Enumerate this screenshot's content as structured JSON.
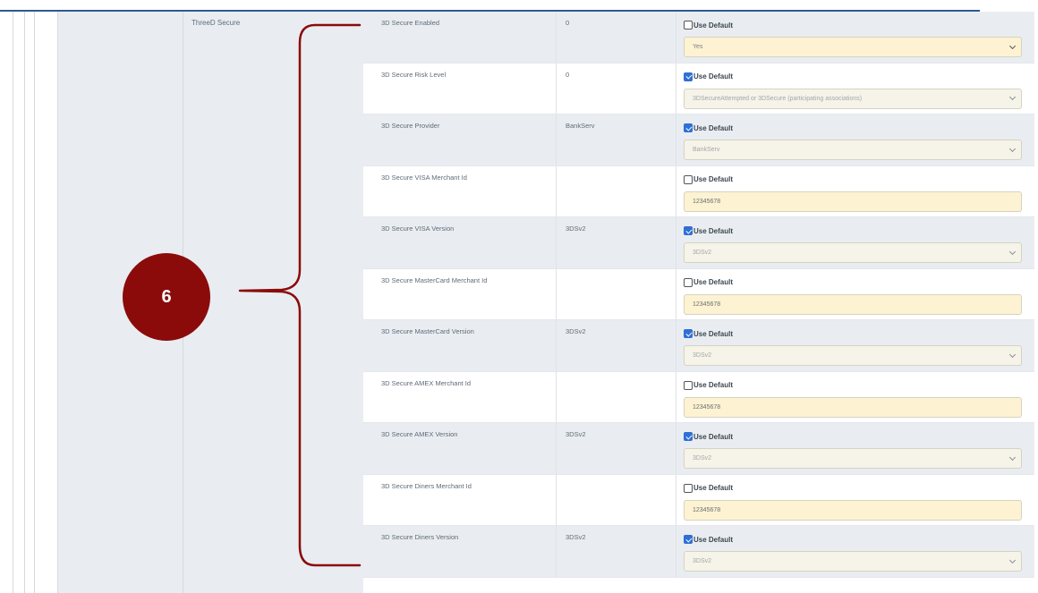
{
  "group": {
    "title": "ThreeD Secure"
  },
  "callout": {
    "number": "6",
    "color": "#8b0b0b"
  },
  "use_default_label": "Use Default",
  "rows": [
    {
      "name": "3D Secure Enabled",
      "value": "0",
      "use_default": false,
      "control": "select",
      "field": "Yes"
    },
    {
      "name": "3D Secure Risk Level",
      "value": "0",
      "use_default": true,
      "control": "select",
      "field": "3DSecureAttempted or 3DSecure (participating associations)"
    },
    {
      "name": "3D Secure Provider",
      "value": "BankServ",
      "use_default": true,
      "control": "select",
      "field": "BankServ"
    },
    {
      "name": "3D Secure VISA Merchant Id",
      "value": "",
      "use_default": false,
      "control": "input",
      "field": "12345678"
    },
    {
      "name": "3D Secure VISA Version",
      "value": "3DSv2",
      "use_default": true,
      "control": "select",
      "field": "3DSv2"
    },
    {
      "name": "3D Secure MasterCard Merchant Id",
      "value": "",
      "use_default": false,
      "control": "input",
      "field": "12345678"
    },
    {
      "name": "3D Secure MasterCard Version",
      "value": "3DSv2",
      "use_default": true,
      "control": "select",
      "field": "3DSv2"
    },
    {
      "name": "3D Secure AMEX Merchant Id",
      "value": "",
      "use_default": false,
      "control": "input",
      "field": "12345678"
    },
    {
      "name": "3D Secure AMEX Version",
      "value": "3DSv2",
      "use_default": true,
      "control": "select",
      "field": "3DSv2"
    },
    {
      "name": "3D Secure Diners Merchant Id",
      "value": "",
      "use_default": false,
      "control": "input",
      "field": "12345678"
    },
    {
      "name": "3D Secure Diners Version",
      "value": "3DSv2",
      "use_default": true,
      "control": "select",
      "field": "3DSv2"
    }
  ]
}
